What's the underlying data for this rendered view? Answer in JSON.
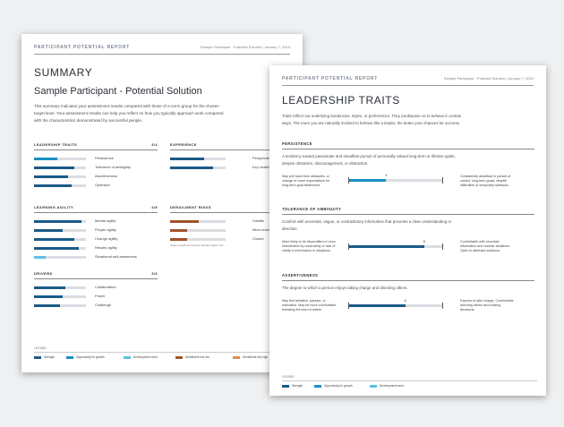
{
  "summary_page": {
    "header_left": "PARTICIPANT POTENTIAL REPORT",
    "header_right": "Sample Participant · Potential Solution | January 7, 2019",
    "title": "SUMMARY",
    "subtitle": "Sample Participant - Potential Solution",
    "intro": [
      "This summary indicates your assessment results compared with those of a norm group for the chosen",
      "target level. Your assessment results can help you reflect on how you typically approach work compared",
      "with the characteristics demonstrated by successful people."
    ],
    "sections": {
      "leadership": {
        "title": "LEADERSHIP TRAITS",
        "count": "3/4",
        "items": [
          {
            "label": "Persistence",
            "value": 0.45,
            "color": "#1a8fc0"
          },
          {
            "label": "Tolerance of ambiguity",
            "value": 0.78,
            "color": "#1a5a86"
          },
          {
            "label": "Assertiveness",
            "value": 0.65,
            "color": "#1a5a86"
          },
          {
            "label": "Optimism",
            "value": 0.72,
            "color": "#1a5a86"
          }
        ]
      },
      "experience": {
        "title": "EXPERIENCE",
        "items": [
          {
            "label": "Perspective",
            "value": 0.62,
            "color": "#1a5a86"
          },
          {
            "label": "Key challenges",
            "value": 0.78,
            "color": "#1a5a86"
          }
        ]
      },
      "agility": {
        "title": "LEARNING AGILITY",
        "count": "4/5",
        "items": [
          {
            "label": "Mental agility",
            "value": 0.92,
            "color": "#1a5a86"
          },
          {
            "label": "People agility",
            "value": 0.55,
            "color": "#1a5a86"
          },
          {
            "label": "Change agility",
            "value": 0.78,
            "color": "#1a5a86"
          },
          {
            "label": "Results agility",
            "value": 0.86,
            "color": "#1a5a86"
          },
          {
            "label": "Situational self-awareness",
            "value": 0.22,
            "color": "#5cc0e6"
          }
        ]
      },
      "derailment": {
        "title": "DERAILMENT RISKS",
        "items": [
          {
            "label": "Volatile",
            "value": 0.52,
            "color": "#a0522d"
          },
          {
            "label": "Micro-managing",
            "value": 0.3,
            "color": "#a0522d"
          },
          {
            "label": "Closed",
            "value": 0.3,
            "color": "#a0522d"
          }
        ],
        "note": "Higher derailment scores indicate higher risk"
      },
      "drivers": {
        "title": "DRIVERS",
        "count": "3/3",
        "items": [
          {
            "label": "Collaboration",
            "value": 0.6,
            "color": "#1a5a86"
          },
          {
            "label": "Power",
            "value": 0.55,
            "color": "#1a5a86"
          },
          {
            "label": "Challenge",
            "value": 0.5,
            "color": "#1a5a86"
          }
        ]
      }
    },
    "legend_title": "LEGEND",
    "legend": [
      {
        "label": "Strength",
        "color": "#1a5a86"
      },
      {
        "label": "Opportunity for growth",
        "color": "#1a8fc0"
      },
      {
        "label": "Development need",
        "color": "#5cc0e6"
      },
      {
        "label": "Derailment risk low",
        "color": "#a0522d"
      },
      {
        "label": "Derailment risk high",
        "color": "#d98a5a"
      }
    ]
  },
  "traits_page": {
    "header_left": "PARTICIPANT POTENTIAL REPORT",
    "header_right": "Sample Participant · Potential Solution | January 7, 2019",
    "title": "LEADERSHIP TRAITS",
    "intro": [
      "Traits reflect our underlying tendencies, styles, or preferences. They predispose us to behave in certain",
      "ways. The more you are naturally inclined to behave like a leader, the better your chances for success."
    ],
    "traits": [
      {
        "title": "PERSISTENCE",
        "desc": [
          "A tendency toward passionate and steadfast pursuit of personally valued long-term or lifetime goals,",
          "despite obstacles, discouragement, or distraction."
        ],
        "left": [
          "May pull back from obstacles, or",
          "change or lower expectations for",
          "long-term goal attainment."
        ],
        "right": [
          "Consistently steadfast in pursuit of",
          "valued, long-term goals, despite",
          "difficulties or temporary setbacks."
        ],
        "score": "4",
        "value": 0.4,
        "color": "#1a8fc0"
      },
      {
        "title": "TOLERANCE OF AMBIGUITY",
        "desc": [
          "Comfort with uncertain, vague, or contradictory information that prevents a clear understanding or",
          "direction."
        ],
        "left": [
          "More likely to be discomfited or even",
          "immobilized by uncertainty or lack of",
          "clarity in information or situations."
        ],
        "right": [
          "Comfortable with uncertain",
          "information and unclear situations.",
          "Open to alternate solutions."
        ],
        "score": "8",
        "value": 0.8,
        "color": "#1a5a86"
      },
      {
        "title": "ASSERTIVENESS",
        "desc": [
          "The degree to which a person enjoys taking charge and directing others."
        ],
        "left": [
          "May feel tentative, passive, or",
          "indecisive. May be more comfortable",
          "following the lead of others."
        ],
        "right": [
          "Expects to take charge. Comfortable",
          "directing others and making",
          "decisions."
        ],
        "score": "6",
        "value": 0.6,
        "color": "#1a5a86"
      }
    ],
    "legend_title": "LEGEND",
    "legend": [
      {
        "label": "Strength",
        "color": "#1a5a86"
      },
      {
        "label": "Opportunity for growth",
        "color": "#1a8fc0"
      },
      {
        "label": "Development need",
        "color": "#5cc0e6"
      }
    ]
  }
}
